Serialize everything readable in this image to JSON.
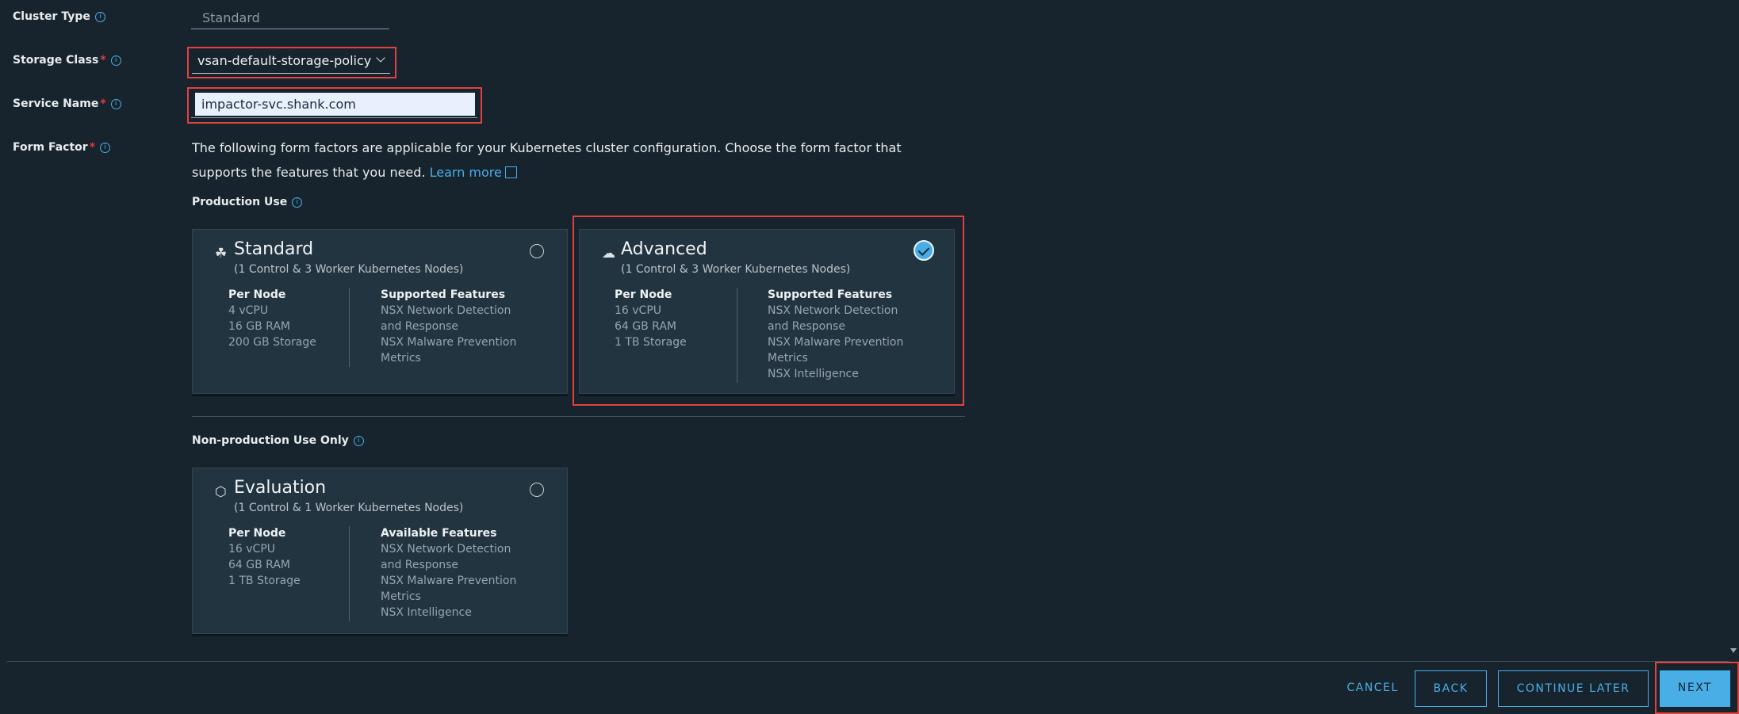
{
  "form": {
    "cluster_type": {
      "label": "Cluster Type",
      "value": "Standard"
    },
    "storage_class": {
      "label": "Storage Class",
      "required": "*",
      "value": "vsan-default-storage-policy"
    },
    "service_name": {
      "label": "Service Name",
      "required": "*",
      "value": "impactor-svc.shank.com"
    },
    "form_factor": {
      "label": "Form Factor",
      "required": "*",
      "description": "The following form factors are applicable for your Kubernetes cluster configuration. Choose the form factor that supports the features that you need.",
      "learn_more": "Learn more"
    }
  },
  "info_icon_glyph": "i",
  "sections": {
    "production": "Production Use",
    "nonproduction": "Non-production Use Only"
  },
  "cards": {
    "standard": {
      "title": "Standard",
      "subtitle": "(1 Control & 3 Worker Kubernetes Nodes)",
      "per_node_heading": "Per Node",
      "per_node": [
        "4 vCPU",
        "16 GB RAM",
        "200 GB Storage"
      ],
      "features_heading": "Supported Features",
      "features": [
        "NSX Network Detection",
        "and Response",
        "NSX Malware Prevention",
        "Metrics"
      ],
      "selected": false
    },
    "advanced": {
      "title": "Advanced",
      "subtitle": "(1 Control & 3 Worker Kubernetes Nodes)",
      "per_node_heading": "Per Node",
      "per_node": [
        "16 vCPU",
        "64 GB RAM",
        "1 TB Storage"
      ],
      "features_heading": "Supported Features",
      "features": [
        "NSX Network Detection",
        "and Response",
        "NSX Malware Prevention",
        "Metrics",
        "NSX Intelligence"
      ],
      "selected": true
    },
    "evaluation": {
      "title": "Evaluation",
      "subtitle": "(1 Control & 1 Worker Kubernetes Nodes)",
      "per_node_heading": "Per Node",
      "per_node": [
        "16 vCPU",
        "64 GB RAM",
        "1 TB Storage"
      ],
      "features_heading": "Available Features",
      "features": [
        "NSX Network Detection",
        "and Response",
        "NSX Malware Prevention",
        "Metrics",
        "NSX Intelligence"
      ],
      "selected": false
    }
  },
  "icons": {
    "standard": "cluster-icon",
    "advanced": "cluster-cloud-icon",
    "evaluation": "hexagon-icon"
  },
  "footer": {
    "cancel": "CANCEL",
    "back": "BACK",
    "continue_later": "CONTINUE LATER",
    "next": "NEXT"
  },
  "colors": {
    "background": "#17242d",
    "card": "#22343f",
    "accent": "#49aee6",
    "highlight": "#e2413f",
    "required": "#e5393f"
  }
}
